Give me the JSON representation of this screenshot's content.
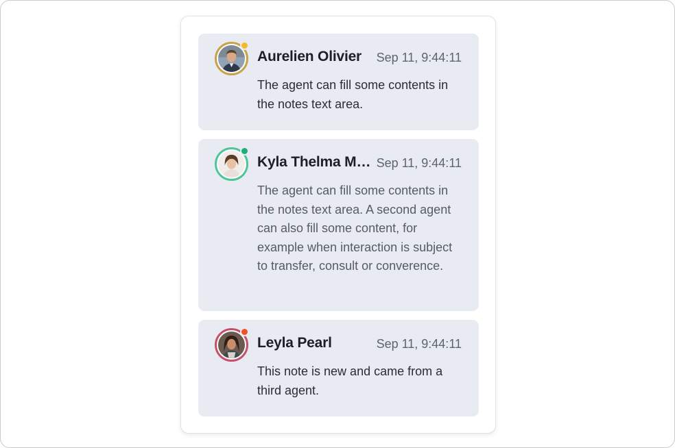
{
  "notes": [
    {
      "author": "Aurelien Olivier",
      "time": "Sep 11, 9:44:11",
      "text": "The agent can fill some contents in the notes text area.",
      "avatar_icon": "male-avatar-icon",
      "ring_color": "#c8a24a",
      "status_color": "#f4b82a"
    },
    {
      "author": "Kyla Thelma Ma...",
      "time": "Sep 11, 9:44:11",
      "text": "The agent can fill some contents in the notes text area. A second agent can also fill some content, for example when interaction is subject to transfer, consult or converence.",
      "avatar_icon": "female-avatar-icon",
      "ring_color": "#4cc59a",
      "status_color": "#1fae78"
    },
    {
      "author": "Leyla Pearl",
      "time": "Sep 11, 9:44:11",
      "text": "This note is new and came from a third agent.",
      "avatar_icon": "female-avatar-icon",
      "ring_color": "#c4506a",
      "status_color": "#f0532a"
    }
  ]
}
